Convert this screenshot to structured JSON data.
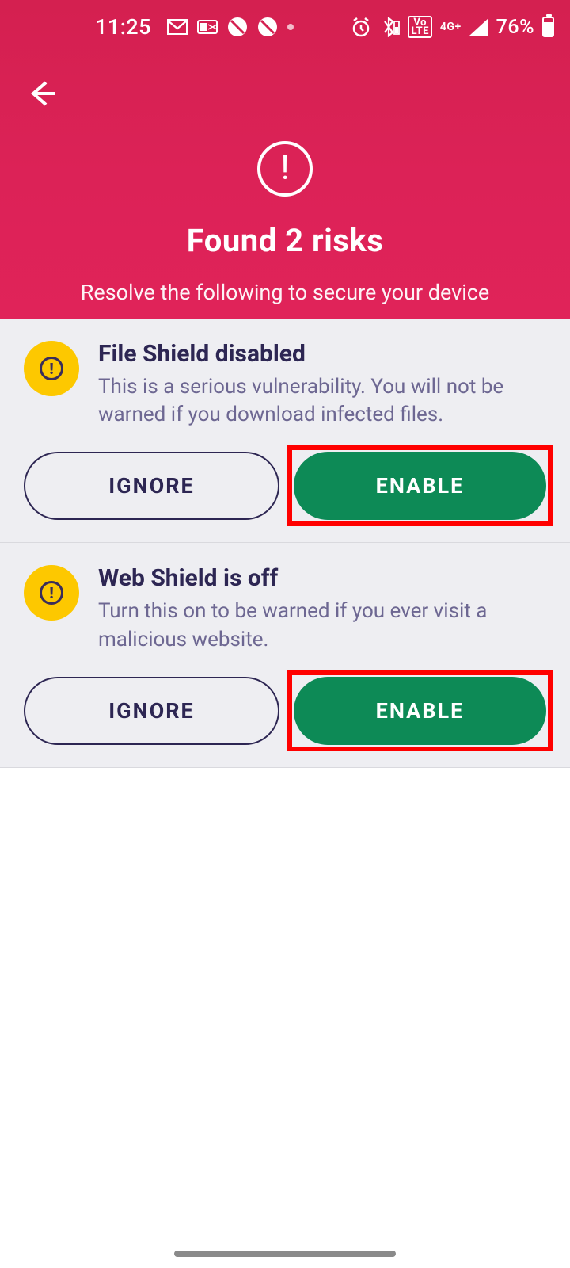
{
  "statusbar": {
    "time": "11:25",
    "battery_text": "76%",
    "lte_label": "Vo\nLTE",
    "net_label": "4G+"
  },
  "header": {
    "title": "Found 2 risks",
    "subtitle": "Resolve the following to secure your device"
  },
  "risks": [
    {
      "title": "File Shield disabled",
      "desc": "This is a serious vulnerability. You will not be warned if you download infected files.",
      "ignore_label": "IGNORE",
      "enable_label": "ENABLE"
    },
    {
      "title": "Web Shield is off",
      "desc": "Turn this on to be warned if you ever visit a malicious website.",
      "ignore_label": "IGNORE",
      "enable_label": "ENABLE"
    }
  ]
}
